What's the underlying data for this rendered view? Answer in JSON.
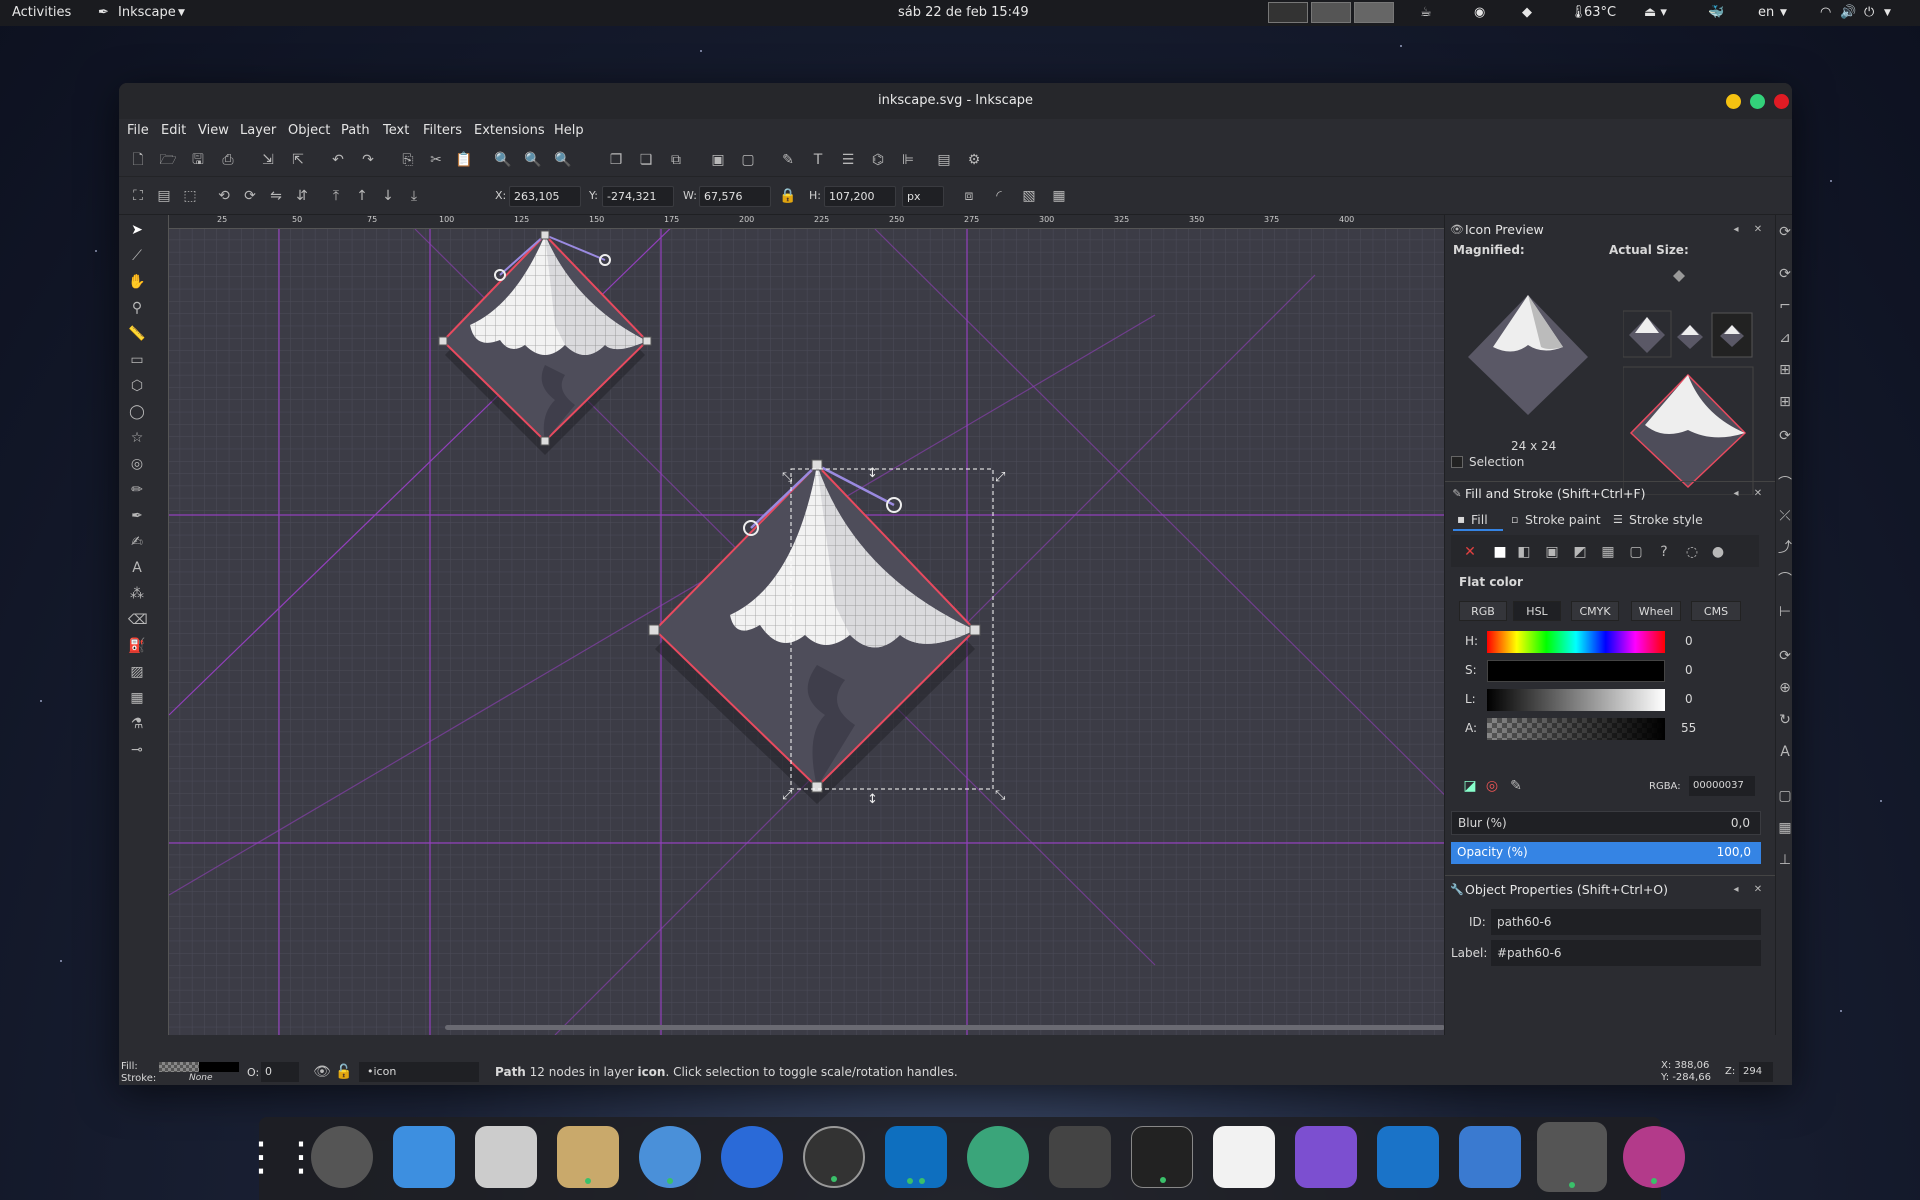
{
  "topbar": {
    "activities": "Activities",
    "app_menu": "Inkscape",
    "datetime": "sáb 22 de feb  15:49",
    "temperature": "63°C",
    "language": "en"
  },
  "window": {
    "title": "inkscape.svg - Inkscape"
  },
  "menu": [
    "File",
    "Edit",
    "View",
    "Layer",
    "Object",
    "Path",
    "Text",
    "Filters",
    "Extensions",
    "Help"
  ],
  "controls": {
    "x_label": "X:",
    "x_value": "263,105",
    "y_label": "Y:",
    "y_value": "-274,321",
    "w_label": "W:",
    "w_value": "67,576",
    "h_label": "H:",
    "h_value": "107,200",
    "unit": "px"
  },
  "ruler_top": [
    "25",
    "50",
    "75",
    "100",
    "125",
    "150",
    "175",
    "200",
    "225",
    "250",
    "275",
    "300",
    "325",
    "350",
    "375",
    "400"
  ],
  "icon_preview": {
    "title": "Icon Preview",
    "magnified": "Magnified:",
    "actual": "Actual Size:",
    "size": "24 x 24",
    "selection": "Selection"
  },
  "fill_stroke": {
    "title": "Fill and Stroke (Shift+Ctrl+F)",
    "tab_fill": "Fill",
    "tab_stroke_paint": "Stroke paint",
    "tab_stroke_style": "Stroke style",
    "flat_color": "Flat color",
    "modes": [
      "RGB",
      "HSL",
      "CMYK",
      "Wheel",
      "CMS"
    ],
    "h_label": "H:",
    "h_value": "0",
    "s_label": "S:",
    "s_value": "0",
    "l_label": "L:",
    "l_value": "0",
    "a_label": "A:",
    "a_value": "55",
    "rgba_label": "RGBA:",
    "rgba_value": "00000037",
    "blur_label": "Blur (%)",
    "blur_value": "0,0",
    "opacity_label": "Opacity (%)",
    "opacity_value": "100,0"
  },
  "object_props": {
    "title": "Object Properties (Shift+Ctrl+O)",
    "id_label": "ID:",
    "id_value": "path60-6",
    "label_label": "Label:",
    "label_value": "#path60-6"
  },
  "status": {
    "fill_label": "Fill:",
    "stroke_label": "Stroke:",
    "stroke_value": "None",
    "o_label": "O:",
    "o_value": "0",
    "layer": "•icon",
    "message_strong": "Path",
    "message": " 12 nodes in layer ",
    "message_layer": "icon",
    "message_tail": ". Click selection to toggle scale/rotation handles.",
    "cursor_x": "X:  388,06",
    "cursor_y": "Y: -284,66",
    "zoom_label": "Z:",
    "zoom_value": "294"
  },
  "colors": {
    "accent": "#3584e4",
    "guide": "#a040d0",
    "canvas": "#3c3c46",
    "selection_stroke": "#e84a5f"
  }
}
